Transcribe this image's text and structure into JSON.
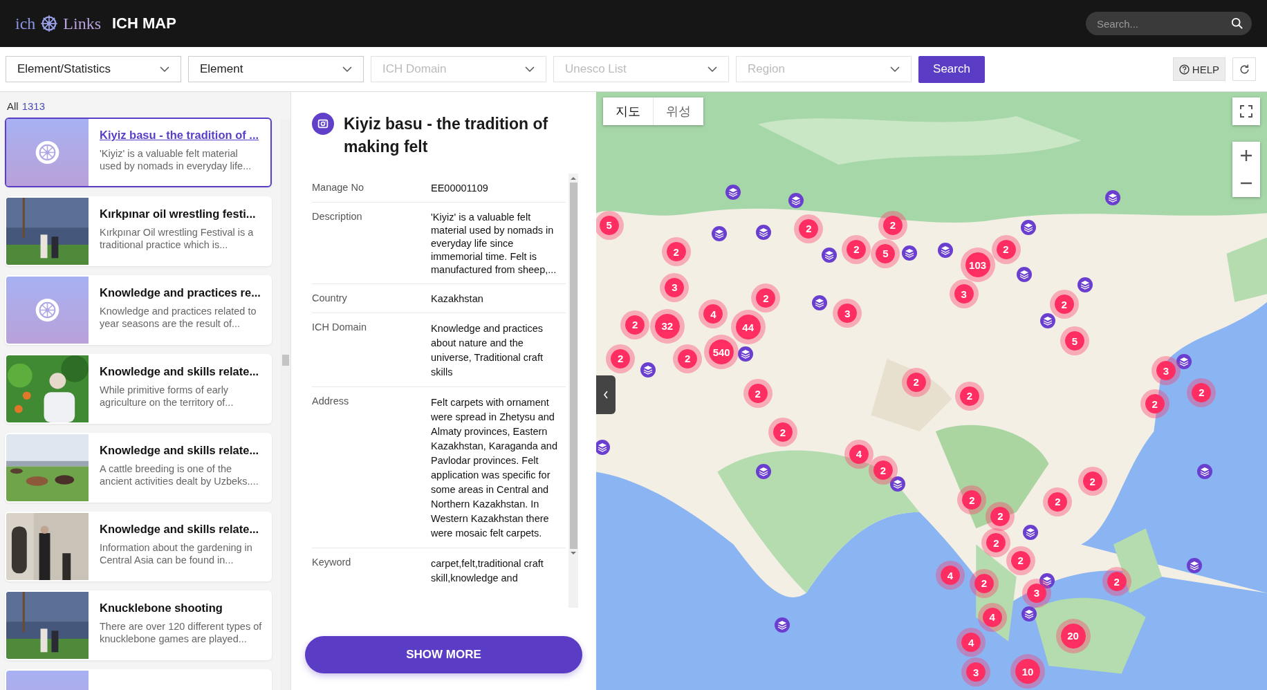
{
  "header": {
    "logo_left": "ich",
    "logo_right": "Links",
    "title": "ICH MAP",
    "search": {
      "placeholder": "Search..."
    }
  },
  "filters": [
    {
      "label": "Element/Statistics",
      "disabled": false
    },
    {
      "label": "Element",
      "disabled": false
    },
    {
      "label": "ICH Domain",
      "disabled": true
    },
    {
      "label": "Unesco List",
      "disabled": true
    },
    {
      "label": "Region",
      "disabled": true
    }
  ],
  "search_button": "Search",
  "help_button": "HELP",
  "list": {
    "all_label": "All",
    "total": "1313",
    "items": [
      {
        "kind": "logo",
        "title": "Kiyiz basu - the tradition of ...",
        "summary": "'Kiyiz' is a valuable felt material used by nomads in everyday life...",
        "selected": true
      },
      {
        "kind": "picture",
        "title": "Kırkpınar oil wrestling festi...",
        "summary": "Kırkpınar Oil wrestling Festival is a traditional practice which is...",
        "selected": false
      },
      {
        "kind": "logo",
        "title": "Knowledge and practices re...",
        "summary": "Knowledge and practices related to year seasons are the result of...",
        "selected": false
      },
      {
        "kind": "picture",
        "title": "Knowledge and skills relate...",
        "summary": "While primitive forms of early agriculture on the territory of...",
        "selected": false
      },
      {
        "kind": "picture",
        "title": "Knowledge and skills relate...",
        "summary": "A cattle breeding is one of the ancient activities dealt by Uzbeks....",
        "selected": false
      },
      {
        "kind": "picture",
        "title": "Knowledge and skills relate...",
        "summary": "Information about the gardening in Central Asia can be found in...",
        "selected": false
      },
      {
        "kind": "picture",
        "title": "Knucklebone shooting",
        "summary": "There are over 120 different types of knucklebone games are played...",
        "selected": false
      },
      {
        "kind": "logo",
        "selected": false
      }
    ]
  },
  "detail": {
    "title": "Kiyiz basu - the tradition of making felt",
    "fields": [
      {
        "label": "Manage No",
        "value": "EE00001109"
      },
      {
        "label": "Description",
        "value": "'Kiyiz' is a valuable felt material used by nomads in everyday life since immemorial time. Felt is manufactured from sheep,..."
      },
      {
        "label": "Country",
        "value": "Kazakhstan"
      },
      {
        "label": "ICH Domain",
        "value": "Knowledge and practices about nature and the universe, Traditional craft skills"
      },
      {
        "label": "Address",
        "value": "Felt carpets with ornament were spread in Zhetysu and Almaty provinces, Eastern Kazakhstan, Karaganda and Pavlodar provinces. Felt application was specific for some areas in Central and Northern Kazakhstan. In Western Kazakhstan there were mosaic felt carpets."
      },
      {
        "label": "Keyword",
        "value": "carpet,felt,traditional craft skill,knowledge and"
      }
    ],
    "show_more": "SHOW MORE"
  },
  "map": {
    "tabs": [
      {
        "label": "지도",
        "selected": true
      },
      {
        "label": "위성",
        "selected": false
      }
    ],
    "clusters": [
      {
        "count": "5"
      },
      {
        "count": "2"
      },
      {
        "count": "2"
      },
      {
        "count": "2"
      },
      {
        "count": "2"
      },
      {
        "count": "5"
      },
      {
        "count": "103"
      },
      {
        "count": "2"
      },
      {
        "count": "3"
      },
      {
        "count": "3"
      },
      {
        "count": "2"
      },
      {
        "count": "3"
      },
      {
        "count": "2"
      },
      {
        "count": "2"
      },
      {
        "count": "32"
      },
      {
        "count": "44"
      },
      {
        "count": "4"
      },
      {
        "count": "540"
      },
      {
        "count": "2"
      },
      {
        "count": "2"
      },
      {
        "count": "5"
      },
      {
        "count": "2"
      },
      {
        "count": "2"
      },
      {
        "count": "2"
      },
      {
        "count": "3"
      },
      {
        "count": "2"
      },
      {
        "count": "2"
      },
      {
        "count": "2"
      },
      {
        "count": "4"
      },
      {
        "count": "2"
      },
      {
        "count": "2"
      },
      {
        "count": "2"
      },
      {
        "count": "2"
      },
      {
        "count": "2"
      },
      {
        "count": "2"
      },
      {
        "count": "4"
      },
      {
        "count": "2"
      },
      {
        "count": "2"
      },
      {
        "count": "3"
      },
      {
        "count": "4"
      },
      {
        "count": "2"
      },
      {
        "count": "20"
      },
      {
        "count": "4"
      },
      {
        "count": "3"
      },
      {
        "count": "10"
      }
    ]
  }
}
